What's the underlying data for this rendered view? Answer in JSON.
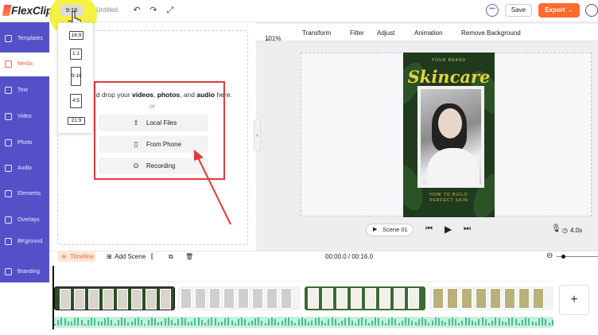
{
  "app": {
    "logo": "FlexClip",
    "title": "Untitled"
  },
  "topbar": {
    "ratio": "9:16",
    "save": "Save",
    "export": "Export →"
  },
  "sidebar": {
    "items": [
      {
        "label": "Templates",
        "icon": "template-icon"
      },
      {
        "label": "Media",
        "icon": "media-icon",
        "active": true
      },
      {
        "label": "Text",
        "icon": "text-icon"
      },
      {
        "label": "Video",
        "icon": "video-icon"
      },
      {
        "label": "Photo",
        "icon": "photo-icon"
      },
      {
        "label": "Audio",
        "icon": "audio-icon"
      },
      {
        "label": "Elements",
        "icon": "elements-icon"
      },
      {
        "label": "Overlays",
        "icon": "overlays-icon"
      },
      {
        "label": "BKground",
        "icon": "background-icon"
      },
      {
        "label": "Branding",
        "icon": "branding-icon"
      }
    ]
  },
  "ratio_menu": {
    "options": [
      "16:9",
      "1:1",
      "9:16",
      "4:5",
      "21:9"
    ],
    "selected": "9:16"
  },
  "media_panel": {
    "drop_prefix": "nd drop your",
    "videos": "videos",
    "photos": "photos",
    "and": ", and",
    "audio": "audio",
    "drop_suffix": "here.",
    "or": "or",
    "buttons": [
      "Local Files",
      "From Phone",
      "Recording"
    ]
  },
  "edit_toolbar": {
    "zoom": "101%",
    "tools": [
      "Transform",
      "Filter",
      "Adjust",
      "Animation",
      "Remove Background"
    ]
  },
  "preview": {
    "brand": "YOUR BRAND",
    "headline": "Skincare",
    "footer_line1": "HOW TO BUILD",
    "footer_line2": "PERFECT SKIN"
  },
  "player": {
    "scene": "Scene 01",
    "duration": "4.0s"
  },
  "timeline": {
    "label": "Timeline",
    "add_scene": "Add Scene",
    "time": "00:00.0 / 00:16.0",
    "add_button": "+"
  },
  "colors": {
    "accent": "#ff6b2c",
    "sidebar": "#5550c8",
    "highlight_red": "#e23a3a"
  }
}
